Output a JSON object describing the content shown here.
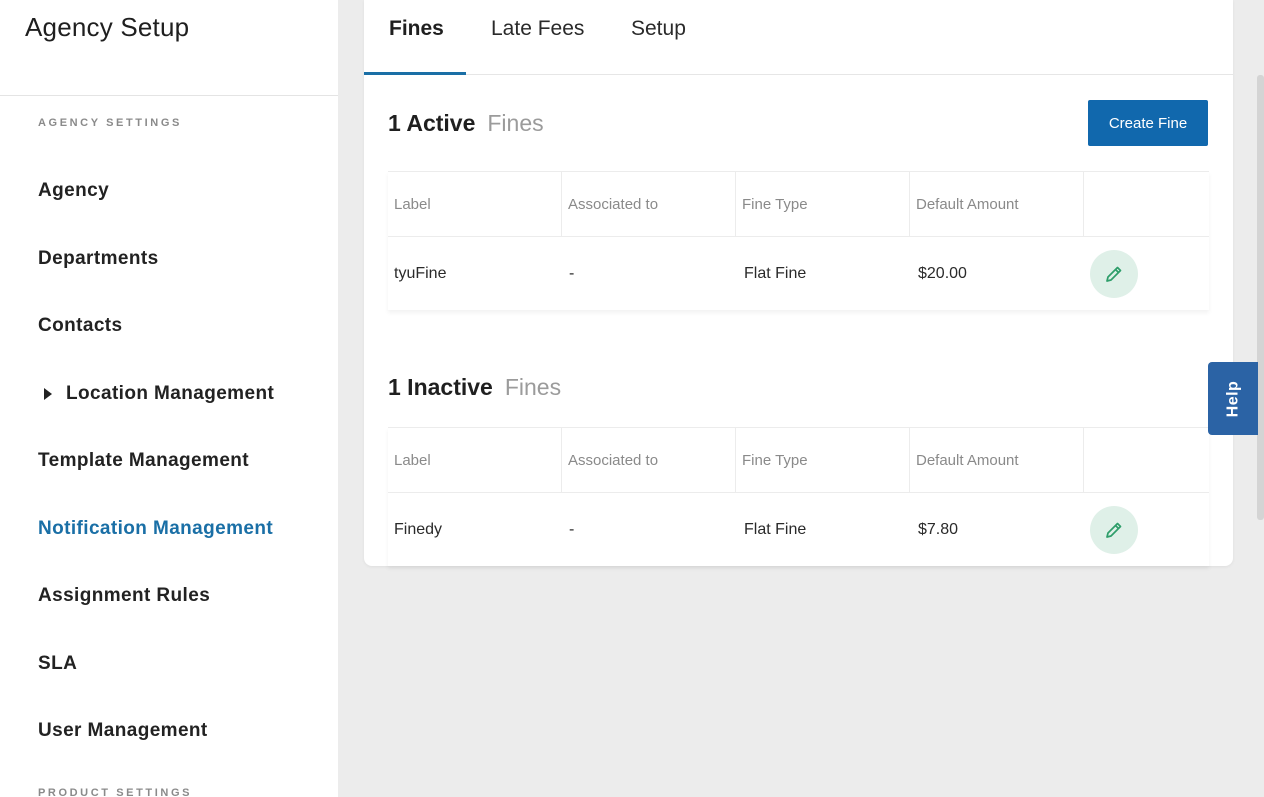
{
  "sidebar": {
    "title": "Agency Setup",
    "section_agency": "AGENCY SETTINGS",
    "section_product": "PRODUCT SETTINGS",
    "items": [
      {
        "label": "Agency"
      },
      {
        "label": "Departments"
      },
      {
        "label": "Contacts"
      },
      {
        "label": "Location Management"
      },
      {
        "label": "Template Management"
      },
      {
        "label": "Notification Management"
      },
      {
        "label": "Assignment Rules"
      },
      {
        "label": "SLA"
      },
      {
        "label": "User Management"
      }
    ],
    "active_item": "Notification Management",
    "active_color": "#1a6fa6"
  },
  "tabs": [
    {
      "label": "Fines"
    },
    {
      "label": "Late Fees"
    },
    {
      "label": "Setup"
    }
  ],
  "active_tab": "Fines",
  "create_button": "Create Fine",
  "columns": [
    "Label",
    "Associated to",
    "Fine Type",
    "Default Amount"
  ],
  "active_section": {
    "count": "1 Active",
    "noun": "Fines",
    "rows": [
      {
        "label": "tyuFine",
        "associated_to": "-",
        "fine_type": "Flat Fine",
        "default_amount": "$20.00"
      }
    ]
  },
  "inactive_section": {
    "count": "1 Inactive",
    "noun": "Fines",
    "rows": [
      {
        "label": "Finedy",
        "associated_to": "-",
        "fine_type": "Flat Fine",
        "default_amount": "$7.80"
      }
    ]
  },
  "help_label": "Help",
  "icons": {
    "edit": "pencil-icon",
    "expand": "caret-right-icon"
  },
  "colors": {
    "primary": "#1168ad",
    "help": "#2b63a5",
    "edit_bg": "#dff0e8",
    "edit_icon": "#2e9e6a"
  }
}
